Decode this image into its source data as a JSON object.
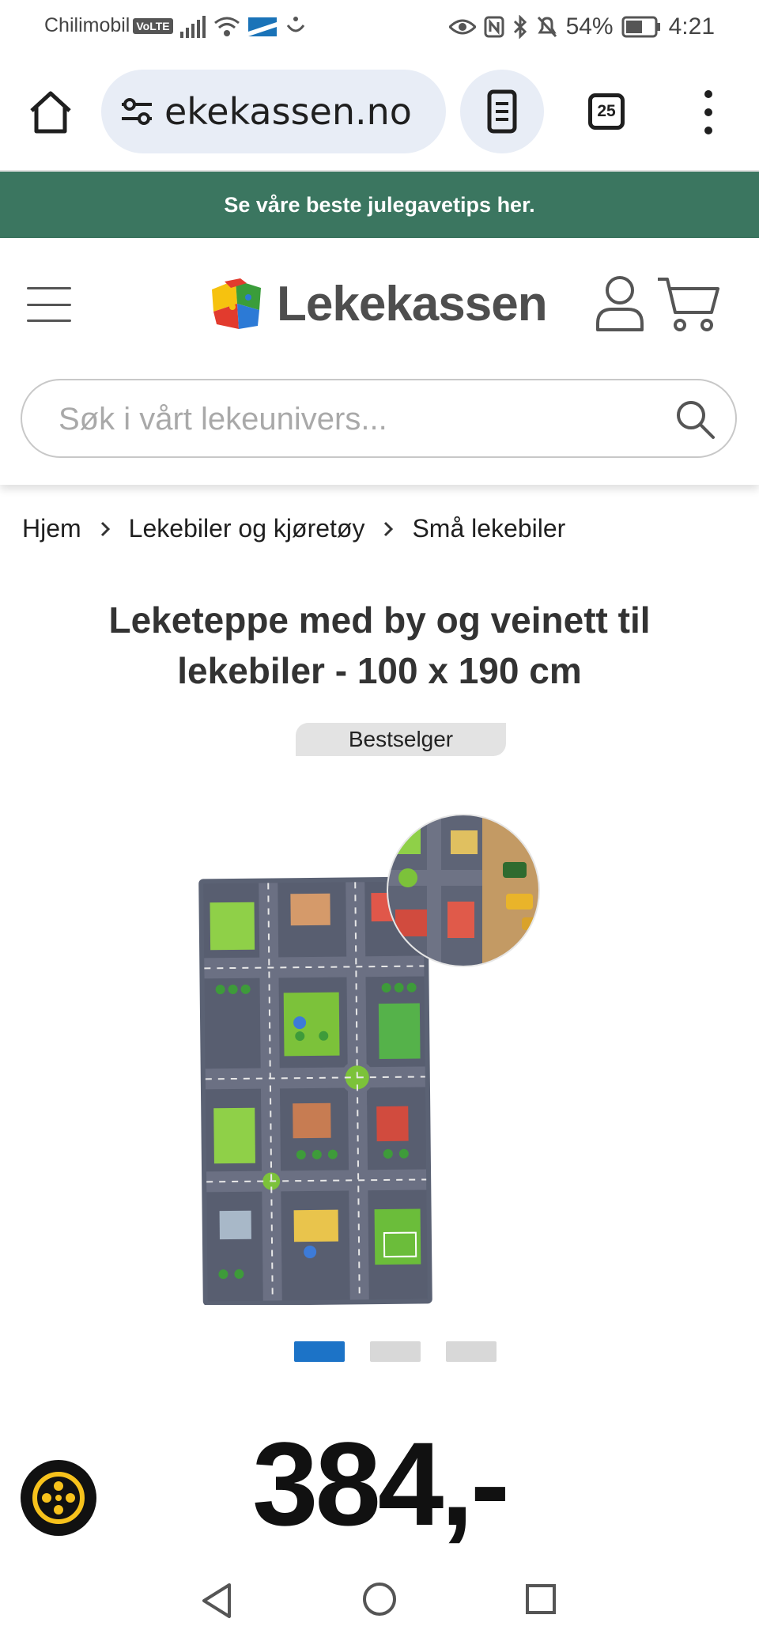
{
  "status_bar": {
    "carrier": "Chilimobil",
    "volte": "VoLTE",
    "battery": "54%",
    "time": "4:21"
  },
  "browser": {
    "url": "ekekassen.no",
    "tab_count": "25"
  },
  "promo": {
    "text": "Se våre beste julegavetips her."
  },
  "site": {
    "logo_text": "Lekekassen",
    "search_placeholder": "Søk i vårt lekeunivers..."
  },
  "breadcrumb": [
    {
      "label": "Hjem"
    },
    {
      "label": "Lekebiler og kjøretøy"
    },
    {
      "label": "Små lekebiler"
    }
  ],
  "product": {
    "title": "Leketeppe med by og veinett til lekebiler - 100 x 190 cm",
    "badge": "Bestselger",
    "price": "384,-",
    "image_count": 3,
    "active_image": 1
  },
  "colors": {
    "promo_bg": "#3b7660",
    "active_dot": "#1c73c7",
    "accessibility_icon": "#f7c21c"
  }
}
